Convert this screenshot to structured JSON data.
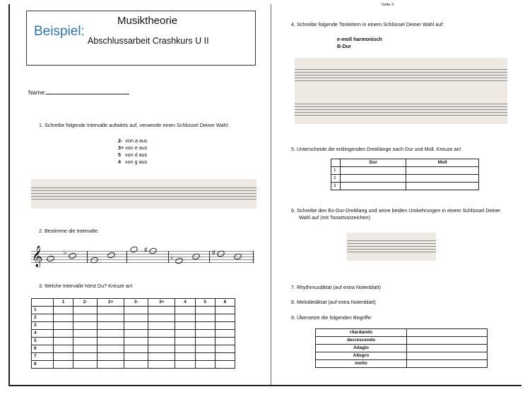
{
  "header": {
    "page_label": "Seite 2"
  },
  "title_box": {
    "beispiel": "Beispiel:",
    "line1": "Musiktheorie",
    "line2": "Abschlussarbeit Crashkurs U II"
  },
  "name_label": "Name:",
  "q1": {
    "text": "1.  Schreibe folgende Intervalle aufwärts auf, verwende einen Schlüssel Deiner Wahl:",
    "items": [
      {
        "interval": "2-",
        "rest": "von a aus"
      },
      {
        "interval": "3+",
        "rest": "von e aus"
      },
      {
        "interval": "5",
        "rest": "von d aus"
      },
      {
        "interval": "4",
        "rest": "von g aus"
      }
    ]
  },
  "q2": {
    "text": "2.  Bestimme die Intervalle:"
  },
  "q3": {
    "text": "3.  Welche Intervalle hörst Du? Kreuze an!",
    "columns": [
      "1",
      "2-",
      "2+",
      "3-",
      "3+",
      "4",
      "5",
      "8"
    ],
    "rows": [
      "1",
      "2",
      "3",
      "4",
      "5",
      "6",
      "7",
      "8"
    ]
  },
  "q4": {
    "text": "4.  Schreibe folgende Tonleitern in einem Schlüssel Deiner Wahl auf:",
    "scale1": "e-moll harmonisch",
    "scale2": "B-Dur"
  },
  "q5": {
    "text": "5.  Unterscheide die erklingenden Dreiklänge nach Dur und Moll. Kreuze an!",
    "columns": [
      "Dur",
      "Moll"
    ],
    "rows": [
      "1",
      "2",
      "3"
    ]
  },
  "q6": {
    "text1": "6.  Schreibe den Es-Dur-Dreiklang und seine beiden Umkehrungen in einem Schlüssel Deiner",
    "text2": "Wahl auf (mit Tonartvorzeichen)"
  },
  "q7": {
    "text": "7.  Rhythmusdiktat (auf extra Notenblatt)"
  },
  "q8": {
    "text": "8.  Melodiediktat (auf extra Notenblatt)"
  },
  "q9": {
    "text": "9.  Übersetze die folgenden Begriffe:",
    "terms": [
      "ritardando",
      "decrescendo",
      "Adagio",
      "Allegro",
      "molto"
    ]
  },
  "colors": {
    "accent": "#2e74b5",
    "staff_bg": "#efe9e3"
  }
}
